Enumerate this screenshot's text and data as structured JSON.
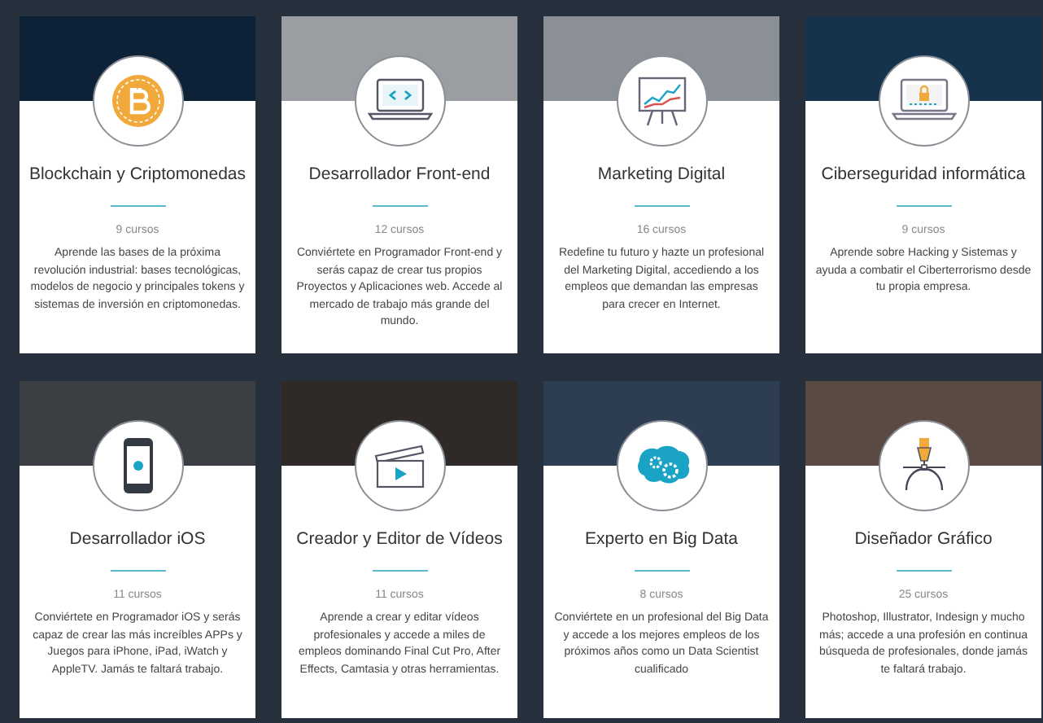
{
  "courses": [
    {
      "kind": "bitcoin",
      "title": "Blockchain y Criptomonedas",
      "count": "9 cursos",
      "description": "Aprende las bases de la próxima revolución industrial: bases tecnológicas, modelos de negocio y principales tokens y sistemas de inversión en criptomonedas."
    },
    {
      "kind": "code",
      "title": "Desarrollador Front-end",
      "count": "12 cursos",
      "description": "Conviértete en Programador Front-end y serás capaz de crear tus propios Proyectos y Aplicaciones web. Accede al mercado de trabajo más grande del mundo."
    },
    {
      "kind": "marketing",
      "title": "Marketing Digital",
      "count": "16 cursos",
      "description": "Redefine tu futuro y hazte un profesional del Marketing Digital, accediendo a los empleos que demandan las empresas para crecer en Internet."
    },
    {
      "kind": "security",
      "title": "Ciberseguridad informática",
      "count": "9 cursos",
      "description": "Aprende sobre Hacking y Sistemas y ayuda a combatir el Ciberterrorismo desde tu propia empresa."
    },
    {
      "kind": "mobile",
      "title": "Desarrollador iOS",
      "count": "11 cursos",
      "description": "Conviértete en Programador iOS y serás capaz de crear las más increíbles APPs y Juegos para iPhone, iPad, iWatch y AppleTV. Jamás te faltará trabajo."
    },
    {
      "kind": "video",
      "title": "Creador y Editor de Vídeos",
      "count": "11 cursos",
      "description": "Aprende a crear y editar vídeos profesionales y accede a miles de empleos dominando Final Cut Pro, After Effects, Camtasia y otras herramientas."
    },
    {
      "kind": "data",
      "title": "Experto en Big Data",
      "count": "8 cursos",
      "description": "Conviértete en un profesional del Big Data y accede a los mejores empleos de los próximos años como un Data Scientist cualificado"
    },
    {
      "kind": "design",
      "title": "Diseñador Gráfico",
      "count": "25 cursos",
      "description": "Photoshop, Illustrator, Indesign y mucho más; accede a una profesión en continua búsqueda de profesionales, donde jamás te faltará trabajo."
    }
  ]
}
